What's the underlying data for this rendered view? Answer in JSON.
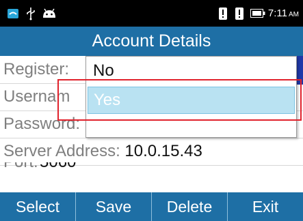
{
  "status_bar": {
    "time": "7:11",
    "ampm": "AM",
    "icons": [
      "app-icon",
      "usb-icon",
      "android-icon",
      "alert-icon",
      "alert-icon",
      "battery-icon"
    ]
  },
  "title": "Account Details",
  "form": {
    "register_label": "Register:",
    "username_label": "Usernam",
    "password_label": "Password:",
    "server_label": "Server Address:",
    "server_value": "10.0.15.43",
    "port_label": "Port:",
    "port_value": "5060"
  },
  "dropdown": {
    "options": [
      "No",
      "Yes"
    ],
    "selected": "No",
    "highlighted": "Yes"
  },
  "buttons": {
    "select": "Select",
    "save": "Save",
    "delete": "Delete",
    "exit": "Exit"
  },
  "colors": {
    "primary": "#1e6fa5",
    "highlight_fill": "#b9e2f2",
    "annotation": "#e0212b"
  }
}
